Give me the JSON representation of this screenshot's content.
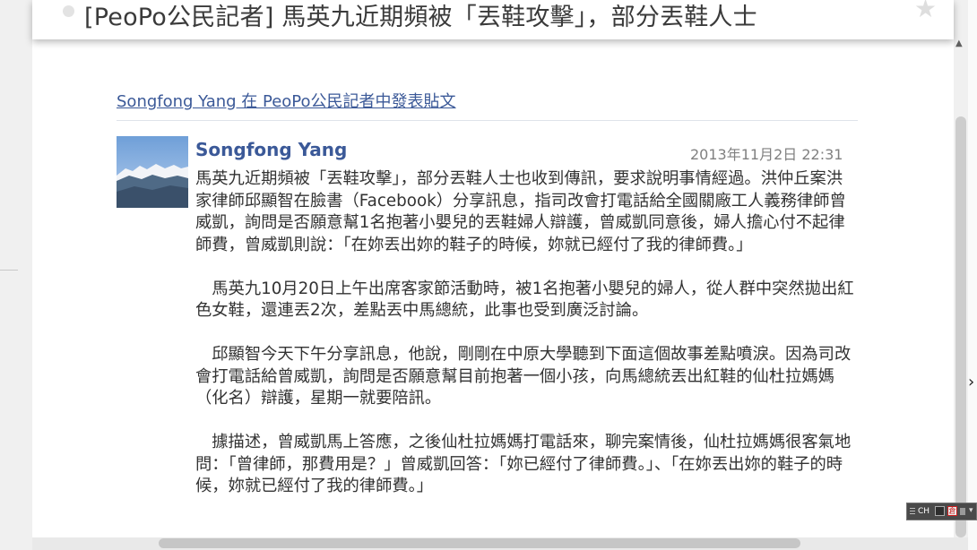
{
  "title_bar": {
    "title": "[PeoPo公民記者] 馬英九近期頻被「丟鞋攻擊」，部分丟鞋人士",
    "icon": "star-icon"
  },
  "post": {
    "header": "Songfong Yang 在 PeoPo公民記者中發表貼文",
    "author": "Songfong Yang",
    "time": "2013年11月2日 22:31",
    "paragraphs": [
      "馬英九近期頻被「丟鞋攻擊」，部分丟鞋人士也收到傳訊，要求說明事情經過。洪仲丘案洪家律師邱顯智在臉書（Facebook）分享訊息，指司改會打電話給全國關廠工人義務律師曾威凱，詢問是否願意幫1名抱著小嬰兒的丟鞋婦人辯護，曾威凱同意後，婦人擔心付不起律師費，曾威凱則說：「在妳丟出妳的鞋子的時候，妳就已經付了我的律師費。」",
      "　馬英九10月20日上午出席客家節活動時，被1名抱著小嬰兒的婦人，從人群中突然拋出紅色女鞋，還連丟2次，差點丟中馬總統，此事也受到廣泛討論。",
      "　邱顯智今天下午分享訊息，他說，剛剛在中原大學聽到下面這個故事差點噴淚。因為司改會打電話給曾威凱，詢問是否願意幫目前抱著一個小孩，向馬總統丟出紅鞋的仙杜拉媽媽（化名）辯護，星期一就要陪訊。",
      "　據描述，曾威凱馬上答應，之後仙杜拉媽媽打電話來，聊完案情後，仙杜拉媽媽很客氣地問：「曾律師，那費用是？」曾威凱回答：「妳已經付了律師費。」、「在妳丟出妳的鞋子的時候，妳就已經付了我的律師費。」"
    ]
  },
  "ime": {
    "lang": "CH",
    "mode_label": "倉"
  },
  "colors": {
    "link_blue": "#3b5998",
    "body_text": "#333333",
    "time_gray": "#808080"
  }
}
